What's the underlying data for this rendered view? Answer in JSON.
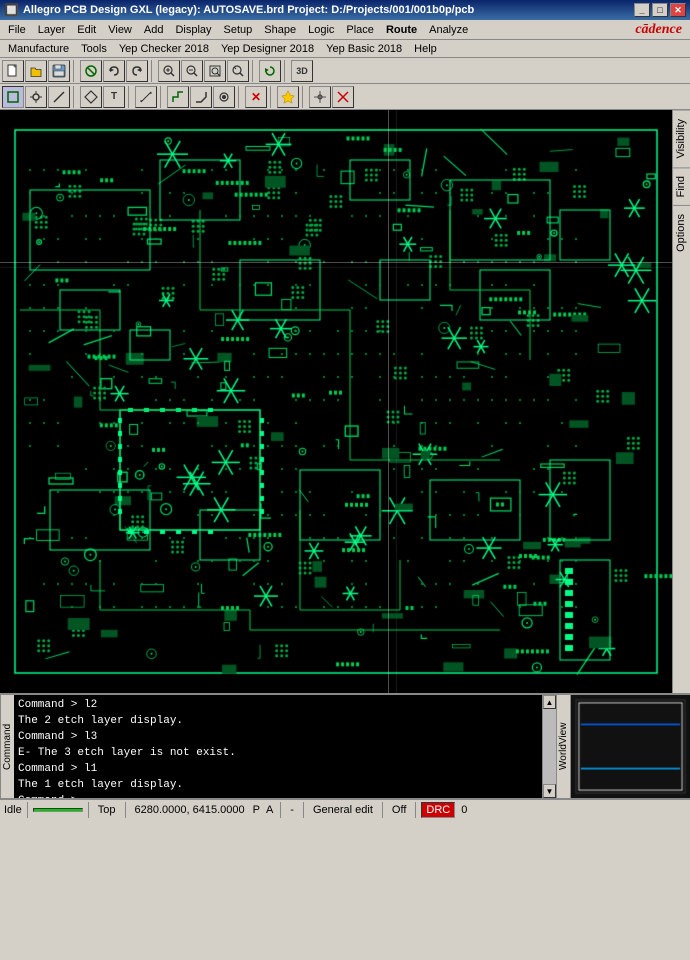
{
  "titlebar": {
    "title": "Allegro PCB Design GXL (legacy): AUTOSAVE.brd  Project: D:/Projects/001/001b0p/pcb",
    "icon": "allegro-icon",
    "controls": [
      "minimize",
      "maximize",
      "close"
    ]
  },
  "menubar": {
    "items": [
      "File",
      "Layer",
      "Edit",
      "View",
      "Add",
      "Display",
      "Setup",
      "Shape",
      "Logic",
      "Place",
      "Route",
      "Analyze",
      "Manufacture",
      "Tools",
      "Yep Checker 2018",
      "Yep Designer 2018",
      "Yep Basic 2018",
      "Help"
    ]
  },
  "cadence_logo": "cādence",
  "toolbar1": {
    "buttons": [
      "new",
      "open",
      "save",
      "sep",
      "add-connect",
      "add-via",
      "sep",
      "undo",
      "redo",
      "sep",
      "zoom-in",
      "zoom-out",
      "zoom-fit",
      "zoom-select",
      "sep",
      "refresh",
      "sep",
      "3d"
    ]
  },
  "toolbar2": {
    "buttons": [
      "box-select",
      "point-select",
      "line-select",
      "sep",
      "snap-grid",
      "snap-pin",
      "sep",
      "measure",
      "sep",
      "layer-up",
      "layer-down",
      "sep",
      "route-seg",
      "route-45",
      "route-90",
      "sep",
      "via",
      "sep",
      "fanout",
      "sep",
      "delete",
      "sep",
      "hilight",
      "dehilight"
    ]
  },
  "right_tabs": [
    "Visibility",
    "Find",
    "Options"
  ],
  "log": {
    "label": "Command",
    "lines": [
      {
        "type": "cmd",
        "text": "Command > l2"
      },
      {
        "type": "info",
        "text": "The 2 etch layer display."
      },
      {
        "type": "cmd",
        "text": "Command > l3"
      },
      {
        "type": "error",
        "text": "E- The 3 etch layer is not exist."
      },
      {
        "type": "cmd",
        "text": "Command > l1"
      },
      {
        "type": "info",
        "text": "The 1 etch layer display."
      },
      {
        "type": "cmd",
        "text": "Command >"
      }
    ]
  },
  "worldview": {
    "label": "WorldView"
  },
  "statusbar": {
    "idle": "Idle",
    "green_indicator": "",
    "layer": "Top",
    "coordinates": "6280.0000, 6415.0000",
    "p_flag": "P",
    "a_flag": "A",
    "dash": "-",
    "mode": "General edit",
    "off": "Off",
    "red_indicator": "DRC",
    "count": "0"
  }
}
